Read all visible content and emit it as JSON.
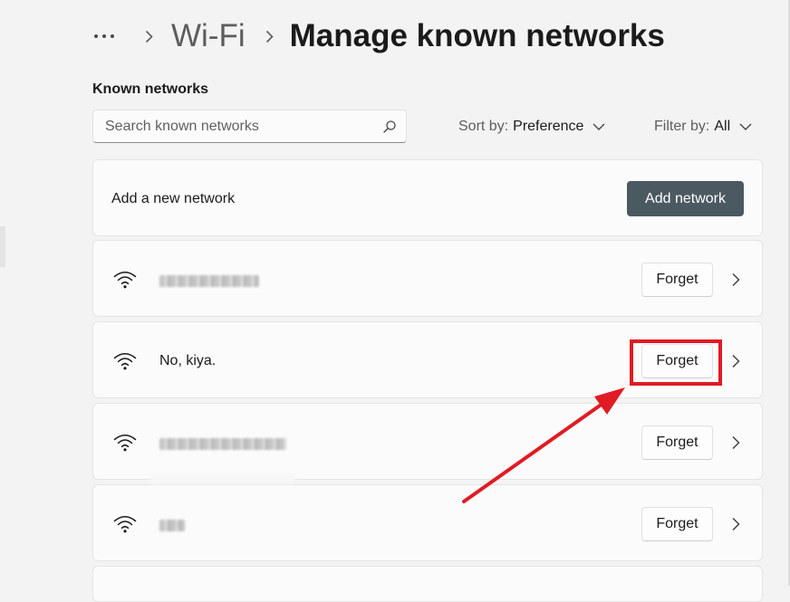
{
  "breadcrumb": {
    "parent": "Wi-Fi",
    "current": "Manage known networks"
  },
  "known_networks": {
    "section_label": "Known networks",
    "search_placeholder": "Search known networks",
    "sort_label": "Sort by:",
    "sort_value": "Preference",
    "filter_label": "Filter by:",
    "filter_value": "All"
  },
  "add_network": {
    "label": "Add a new network",
    "button_label": "Add network"
  },
  "networks": [
    {
      "name": "",
      "forget_label": "Forget"
    },
    {
      "name": "No, kiya.",
      "forget_label": "Forget"
    },
    {
      "name": "",
      "forget_label": "Forget"
    },
    {
      "name": "",
      "forget_label": "Forget"
    }
  ],
  "colors": {
    "background": "#f3f3f3",
    "card": "#fbfbfb",
    "primary_button": "#4b5961",
    "annotation_red": "#e01b24"
  }
}
